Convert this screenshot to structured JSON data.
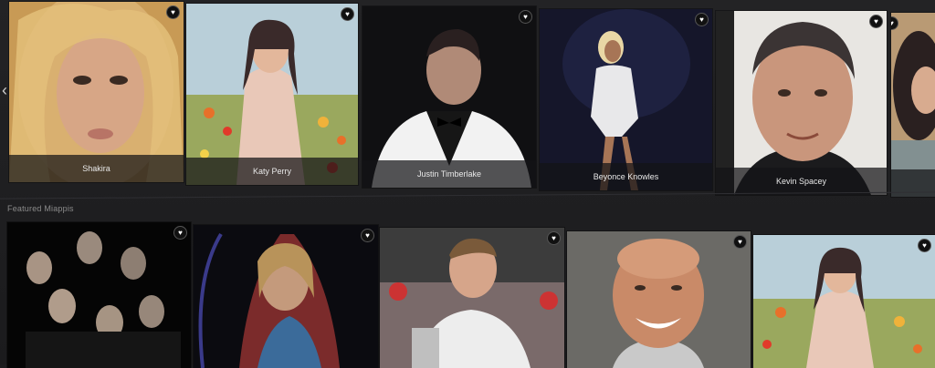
{
  "nav": {
    "prev_glyph": "‹"
  },
  "section": {
    "title": "Featured Miappis"
  },
  "favorite_glyph": "♥",
  "top_row": [
    {
      "name": "Shakira"
    },
    {
      "name": "Katy Perry"
    },
    {
      "name": "Justin Timberlake"
    },
    {
      "name": "Beyonce Knowles"
    },
    {
      "name": "Kevin Spacey"
    },
    {
      "name": ""
    }
  ],
  "bottom_row": [
    {
      "name": ""
    },
    {
      "name": ""
    },
    {
      "name": ""
    },
    {
      "name": ""
    },
    {
      "name": ""
    }
  ]
}
